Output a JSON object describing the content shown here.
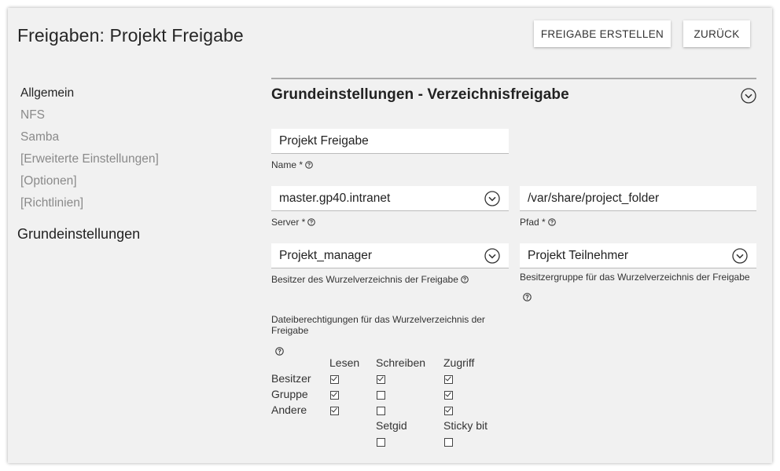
{
  "header": {
    "title": "Freigaben: Projekt Freigabe",
    "create_label": "FREIGABE ERSTELLEN",
    "back_label": "ZURÜCK"
  },
  "sidebar": {
    "items": [
      {
        "label": "Allgemein",
        "active": true
      },
      {
        "label": "NFS",
        "active": false
      },
      {
        "label": "Samba",
        "active": false
      },
      {
        "label": "[Erweiterte Einstellungen]",
        "active": false
      },
      {
        "label": "[Optionen]",
        "active": false
      },
      {
        "label": "[Richtlinien]",
        "active": false
      }
    ],
    "section_title": "Grundeinstellungen"
  },
  "main": {
    "section_title": "Grundeinstellungen - Verzeichnisfreigabe",
    "name": {
      "value": "Projekt Freigabe",
      "label": "Name *"
    },
    "server": {
      "value": "master.gp40.intranet",
      "label": "Server *"
    },
    "path": {
      "value": "/var/share/project_folder",
      "label": "Pfad *"
    },
    "owner": {
      "value": "Projekt_manager",
      "label": "Besitzer des Wurzelverzeichnis der Freigabe"
    },
    "group": {
      "value": "Projekt Teilnehmer",
      "label": "Besitzergruppe für das Wurzelverzeichnis der Freigabe"
    },
    "permissions": {
      "label": "Dateiberechtigungen für das Wurzelverzeichnis der Freigabe",
      "columns": [
        "Lesen",
        "Schreiben",
        "Zugriff"
      ],
      "rows": [
        {
          "label": "Besitzer",
          "checked": [
            true,
            true,
            true
          ]
        },
        {
          "label": "Gruppe",
          "checked": [
            true,
            false,
            true
          ]
        },
        {
          "label": "Andere",
          "checked": [
            true,
            false,
            true
          ]
        }
      ],
      "setgid_label": "Setgid",
      "setgid_checked": false,
      "sticky_label": "Sticky bit",
      "sticky_checked": false
    }
  },
  "icons": {
    "dropdown": "chevron-down-circle-icon",
    "help": "question-circle-icon",
    "collapse": "chevron-down-circle-icon"
  }
}
